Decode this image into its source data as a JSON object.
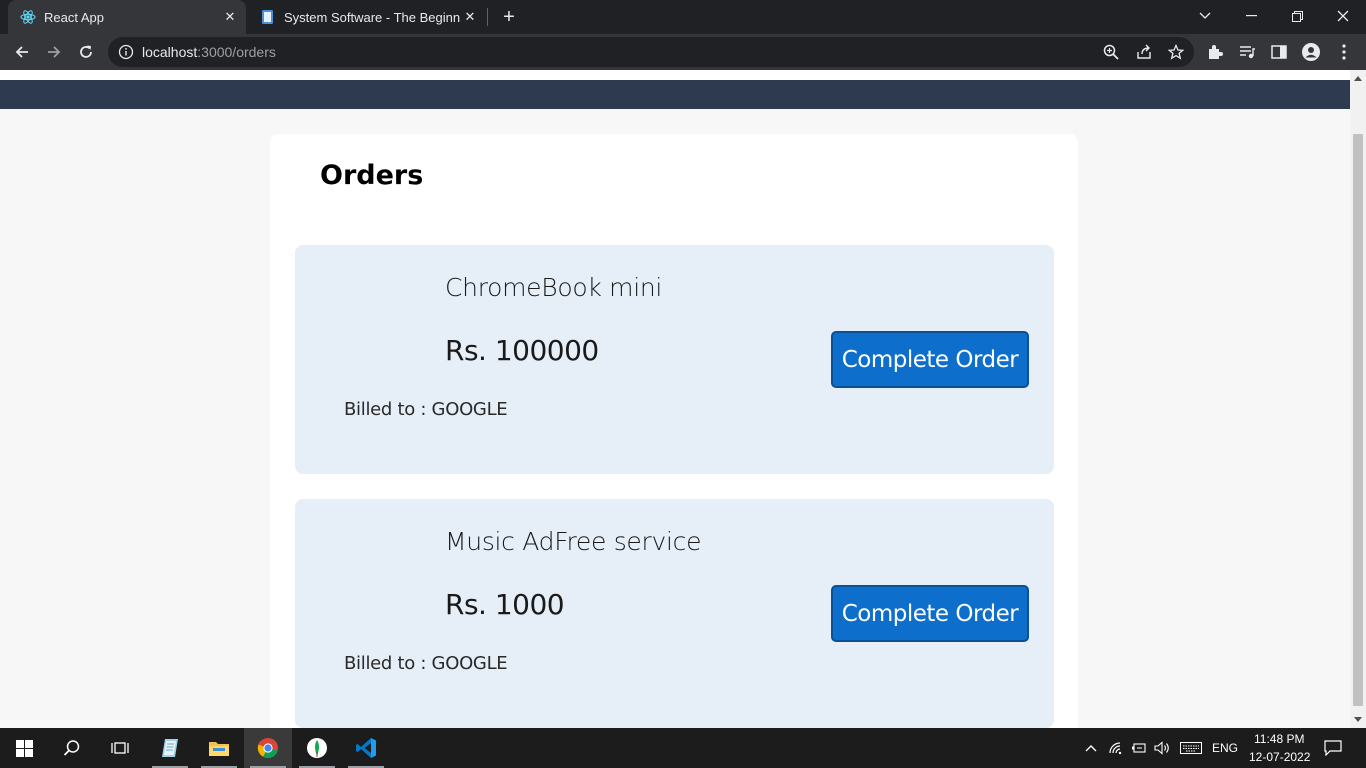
{
  "browser": {
    "tabs": [
      {
        "title": "React App",
        "icon": "react-icon",
        "active": true
      },
      {
        "title": "System Software - The Beginning",
        "icon": "document-icon",
        "active": false
      }
    ],
    "url_host": "localhost",
    "url_path": ":3000/orders"
  },
  "page": {
    "title": "Orders",
    "orders": [
      {
        "name": "ChromeBook mini",
        "price": "Rs. 100000",
        "billed": "Billed to : GOOGLE",
        "action": "Complete Order"
      },
      {
        "name": "Music AdFree service",
        "price": "Rs. 1000",
        "billed": "Billed to : GOOGLE",
        "action": "Complete Order"
      }
    ]
  },
  "taskbar": {
    "language": "ENG",
    "time": "11:48 PM",
    "date": "12-07-2022",
    "apps": [
      "start-icon",
      "search-icon",
      "task-view-icon",
      "notepad-icon",
      "file-explorer-icon",
      "chrome-icon",
      "mongodb-compass-icon",
      "vscode-icon"
    ]
  },
  "colors": {
    "navbar": "#2d3a4f",
    "card": "#e6eef8",
    "button": "#0d6ecb"
  }
}
